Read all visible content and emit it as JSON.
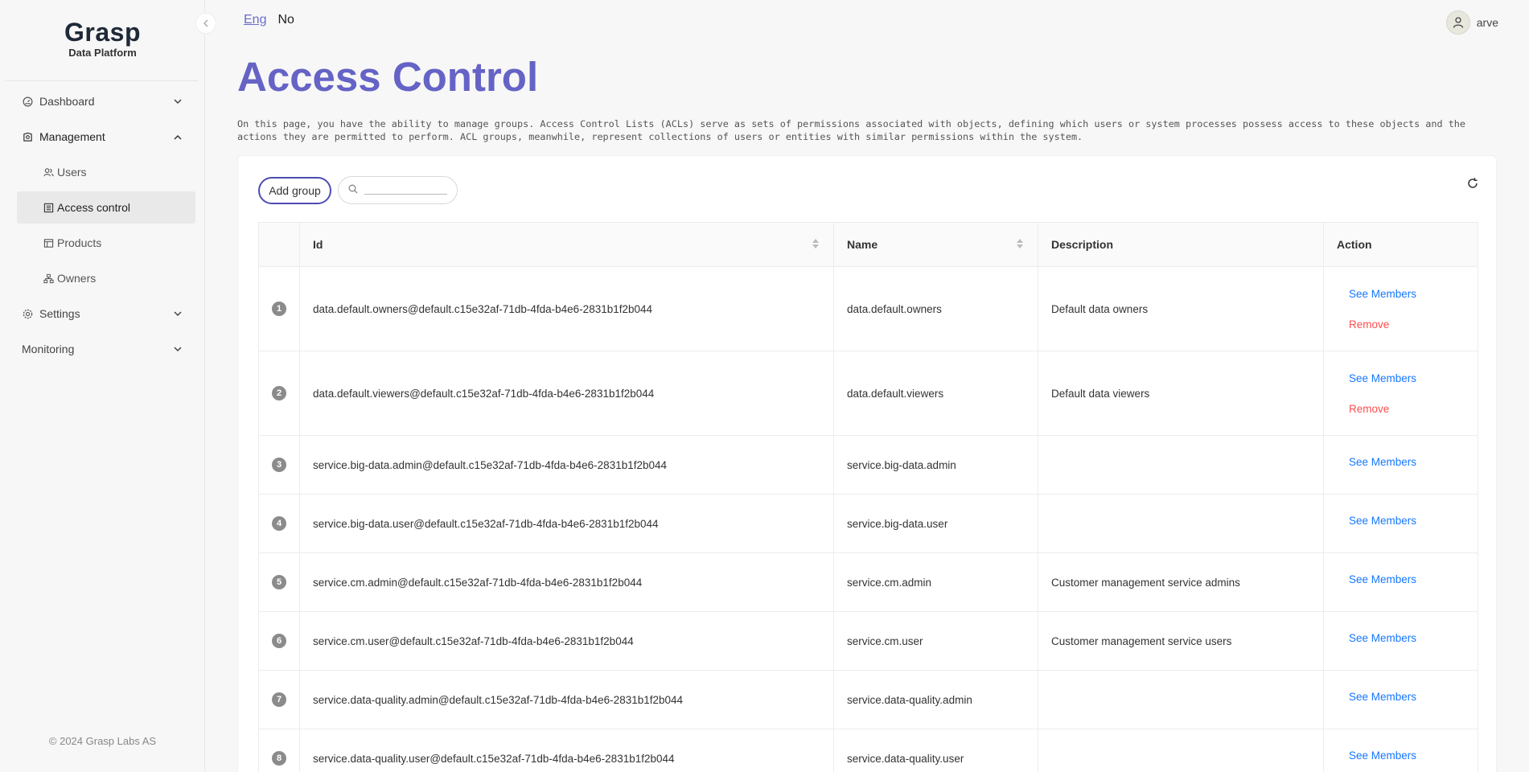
{
  "sidebar": {
    "logo_title": "Grasp",
    "logo_sub": "Data Platform",
    "items": [
      {
        "label": "Dashboard"
      },
      {
        "label": "Management"
      },
      {
        "label": "Settings"
      },
      {
        "label": "Monitoring"
      }
    ],
    "sub_items": [
      {
        "label": "Users"
      },
      {
        "label": "Access control"
      },
      {
        "label": "Products"
      },
      {
        "label": "Owners"
      }
    ],
    "active_sub": "Access control",
    "footer": "© 2024 Grasp Labs AS"
  },
  "topbar": {
    "lang_eng": "Eng",
    "lang_no": "No",
    "username": "arve"
  },
  "page": {
    "title": "Access Control",
    "description": "On this page, you have the ability to manage groups. Access Control Lists (ACLs) serve as sets of permissions associated with objects, defining which users or system processes possess access to these objects and the actions they are permitted to perform. ACL groups, meanwhile, represent collections of users or entities with similar permissions within the system."
  },
  "toolbar": {
    "add_group_label": "Add group",
    "search_placeholder": ""
  },
  "table": {
    "columns": [
      "Id",
      "Name",
      "Description",
      "Action"
    ],
    "rows": [
      {
        "num": "1",
        "id": "data.default.owners@default.c15e32af-71db-4fda-b4e6-2831b1f2b044",
        "name": "data.default.owners",
        "description": "Default data owners",
        "see": "See Members",
        "remove": "Remove"
      },
      {
        "num": "2",
        "id": "data.default.viewers@default.c15e32af-71db-4fda-b4e6-2831b1f2b044",
        "name": "data.default.viewers",
        "description": "Default data viewers",
        "see": "See Members",
        "remove": "Remove"
      },
      {
        "num": "3",
        "id": "service.big-data.admin@default.c15e32af-71db-4fda-b4e6-2831b1f2b044",
        "name": "service.big-data.admin",
        "description": "",
        "see": "See Members"
      },
      {
        "num": "4",
        "id": "service.big-data.user@default.c15e32af-71db-4fda-b4e6-2831b1f2b044",
        "name": "service.big-data.user",
        "description": "",
        "see": "See Members"
      },
      {
        "num": "5",
        "id": "service.cm.admin@default.c15e32af-71db-4fda-b4e6-2831b1f2b044",
        "name": "service.cm.admin",
        "description": "Customer management service admins",
        "see": "See Members"
      },
      {
        "num": "6",
        "id": "service.cm.user@default.c15e32af-71db-4fda-b4e6-2831b1f2b044",
        "name": "service.cm.user",
        "description": "Customer management service users",
        "see": "See Members"
      },
      {
        "num": "7",
        "id": "service.data-quality.admin@default.c15e32af-71db-4fda-b4e6-2831b1f2b044",
        "name": "service.data-quality.admin",
        "description": "",
        "see": "See Members"
      },
      {
        "num": "8",
        "id": "service.data-quality.user@default.c15e32af-71db-4fda-b4e6-2831b1f2b044",
        "name": "service.data-quality.user",
        "description": "",
        "see": "See Members"
      }
    ]
  },
  "colors": {
    "accent": "#6563c6",
    "link": "#1677ff",
    "danger": "#ff4d4f"
  }
}
